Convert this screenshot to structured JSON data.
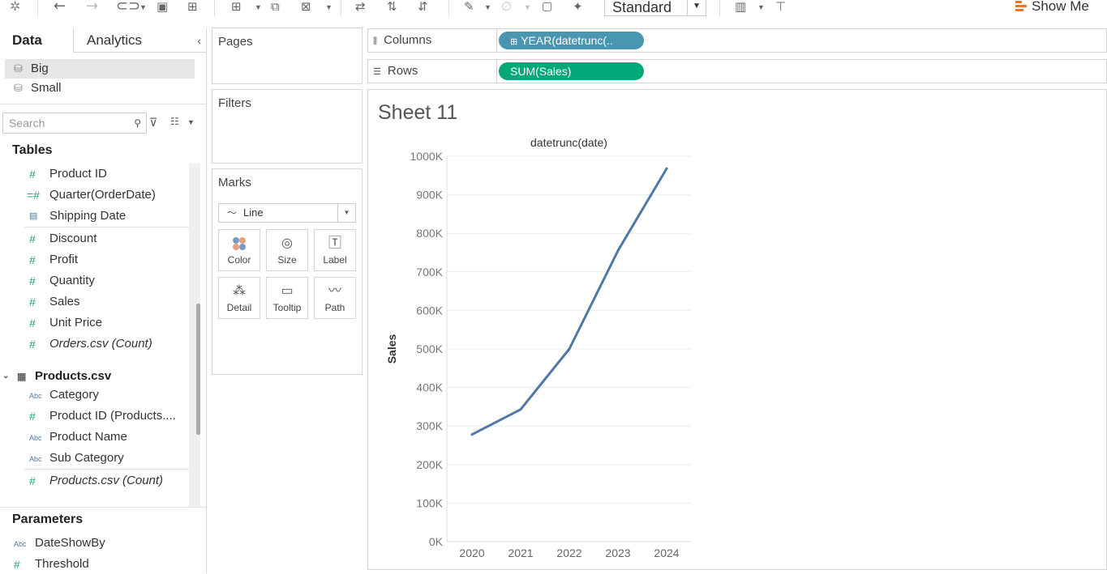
{
  "toolbar": {
    "icons": [
      "tableau-logo-icon",
      "undo-icon",
      "redo-icon",
      "data-source-icon",
      "save-icon",
      "new-datasource-icon",
      "new-worksheet-icon",
      "duplicate-sheet-icon",
      "clear-sheet-icon",
      "swap-icon",
      "sort-ascending-icon",
      "sort-descending-icon",
      "highlight-icon",
      "group-icon",
      "label-icon",
      "pin-icon",
      "show-cards-icon",
      "presentation-icon"
    ],
    "fit_select": "Standard",
    "show_me": "Show Me"
  },
  "data_pane": {
    "tab_data": "Data",
    "tab_analytics": "Analytics",
    "collapse": "‹",
    "datasources": [
      "Big",
      "Small"
    ],
    "search_placeholder": "Search",
    "tables_title": "Tables",
    "fields_top": [
      {
        "name": "Product ID",
        "icon": "#"
      },
      {
        "name": "Quarter(OrderDate)",
        "icon": "=#"
      },
      {
        "name": "Shipping Date",
        "icon": "cal"
      }
    ],
    "fields_measures": [
      {
        "name": "Discount",
        "icon": "#"
      },
      {
        "name": "Profit",
        "icon": "#"
      },
      {
        "name": "Quantity",
        "icon": "#"
      },
      {
        "name": "Sales",
        "icon": "#"
      },
      {
        "name": "Unit Price",
        "icon": "#"
      },
      {
        "name": "Orders.csv (Count)",
        "icon": "#",
        "italic": true
      }
    ],
    "products_table": "Products.csv",
    "products_fields": [
      {
        "name": "Category",
        "icon": "Abc"
      },
      {
        "name": "Product ID (Products....",
        "icon": "#"
      },
      {
        "name": "Product Name",
        "icon": "Abc"
      },
      {
        "name": "Sub Category",
        "icon": "Abc"
      }
    ],
    "products_count": "Products.csv (Count)",
    "parameters_title": "Parameters",
    "parameters": [
      {
        "name": "DateShowBy",
        "icon": "Abc"
      },
      {
        "name": "Threshold",
        "icon": "#"
      }
    ]
  },
  "cards": {
    "pages": "Pages",
    "filters": "Filters",
    "marks": "Marks",
    "mark_type": "Line",
    "mark_buttons": [
      "Color",
      "Size",
      "Label",
      "Detail",
      "Tooltip",
      "Path"
    ]
  },
  "shelves": {
    "columns_label": "Columns",
    "columns_pill": "YEAR(datetrunc(..",
    "rows_label": "Rows",
    "rows_pill": "SUM(Sales)",
    "columns_pill_color": "#4996b2",
    "rows_pill_color": "#00a977"
  },
  "sheet": {
    "title": "Sheet 11"
  },
  "chart_data": {
    "type": "line",
    "title": "datetrunc(date)",
    "xlabel": "datetrunc(date)",
    "ylabel": "Sales",
    "categories": [
      "2020",
      "2021",
      "2022",
      "2023",
      "2024"
    ],
    "series": [
      {
        "values": [
          278000,
          343000,
          500000,
          755000,
          968000
        ]
      }
    ],
    "ylim": [
      0,
      1000000
    ],
    "yticks": [
      0,
      100000,
      200000,
      300000,
      400000,
      500000,
      600000,
      700000,
      800000,
      900000,
      1000000
    ],
    "ytick_labels": [
      "0K",
      "100K",
      "200K",
      "300K",
      "400K",
      "500K",
      "600K",
      "700K",
      "800K",
      "900K",
      "1000K"
    ],
    "line_color": "#4e79a7",
    "grid": true
  }
}
